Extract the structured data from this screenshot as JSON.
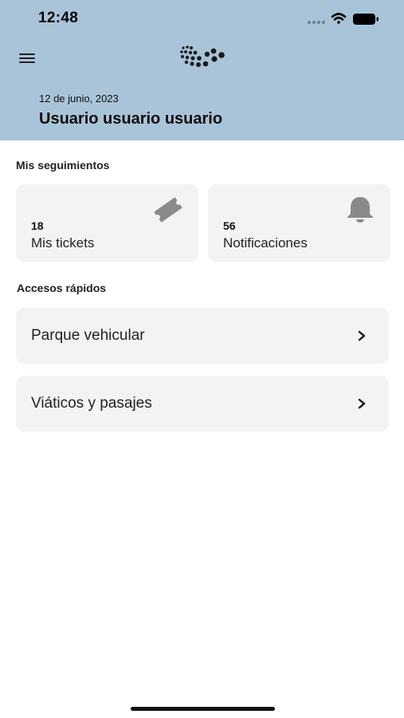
{
  "status_bar": {
    "time": "12:48"
  },
  "header": {
    "date": "12 de junio, 2023",
    "user_name": "Usuario usuario usuario",
    "background": "#a9c4d8"
  },
  "tracking": {
    "title": "Mis seguimientos",
    "cards": [
      {
        "count": "18",
        "label": "Mis tickets",
        "icon": "ticket-icon"
      },
      {
        "count": "56",
        "label": "Notificaciones",
        "icon": "bell-icon"
      }
    ]
  },
  "quick_access": {
    "title": "Accesos rápidos",
    "items": [
      {
        "label": "Parque vehicular",
        "icon": "chevron-right-icon"
      },
      {
        "label": "Viáticos y pasajes",
        "icon": "chevron-right-icon"
      }
    ]
  },
  "colors": {
    "card_background": "#f3f3f3",
    "icon_gray": "#8a8a8a"
  }
}
